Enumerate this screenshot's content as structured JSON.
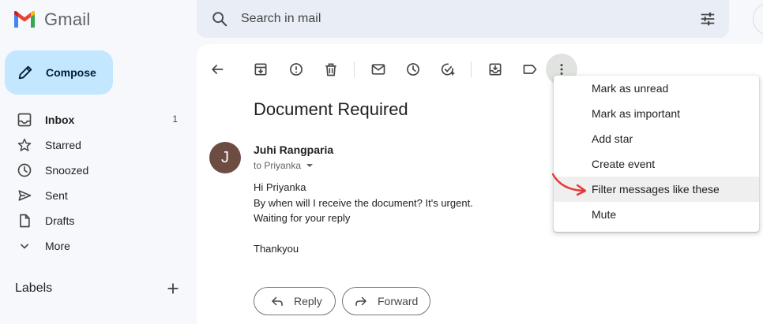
{
  "app": {
    "name": "Gmail"
  },
  "search": {
    "placeholder": "Search in mail"
  },
  "compose": {
    "label": "Compose"
  },
  "sidebar": {
    "items": [
      {
        "label": "Inbox",
        "count": "1",
        "icon": "inbox-icon"
      },
      {
        "label": "Starred",
        "count": "",
        "icon": "star-icon"
      },
      {
        "label": "Snoozed",
        "count": "",
        "icon": "clock-icon"
      },
      {
        "label": "Sent",
        "count": "",
        "icon": "send-icon"
      },
      {
        "label": "Drafts",
        "count": "",
        "icon": "draft-icon"
      },
      {
        "label": "More",
        "count": "",
        "icon": "chevron-down-icon"
      }
    ],
    "labels_title": "Labels"
  },
  "toolbar": {
    "icons": [
      "back-icon",
      "archive-icon",
      "report-spam-icon",
      "delete-icon",
      "mark-unread-icon",
      "snooze-icon",
      "add-task-icon",
      "move-to-icon",
      "label-icon",
      "more-vert-icon"
    ]
  },
  "email": {
    "subject": "Document Required",
    "avatar_letter": "J",
    "sender": "Juhi Rangparia",
    "recipient": "to Priyanka",
    "body": [
      "Hi Priyanka",
      "By when will I receive the document? It's urgent.",
      "Waiting for your reply",
      "",
      "Thankyou"
    ]
  },
  "actions": {
    "reply": "Reply",
    "forward": "Forward"
  },
  "menu": {
    "items": [
      "Mark as unread",
      "Mark as important",
      "Add star",
      "Create event",
      "Filter messages like these",
      "Mute"
    ],
    "highlighted_index": 4
  },
  "colors": {
    "compose_bg": "#c2e7ff",
    "search_bg": "#e9eef6",
    "avatar_bg": "#6d4c41",
    "annotation_arrow": "#e53935"
  }
}
